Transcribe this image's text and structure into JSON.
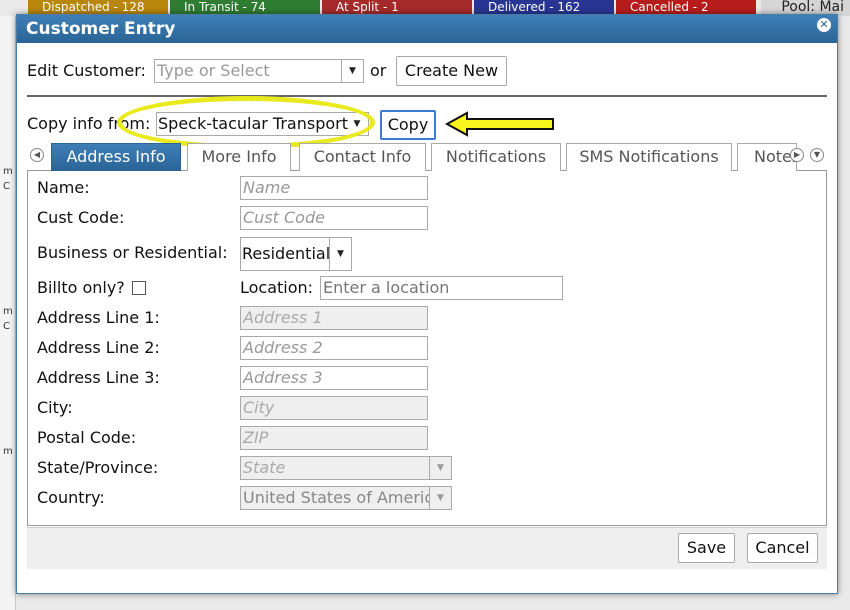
{
  "background": {
    "pills": [
      {
        "label": "Dispatched - 128",
        "color": "#b8860b",
        "width": 140
      },
      {
        "label": "In Transit - 74",
        "color": "#2e7d32",
        "width": 150
      },
      {
        "label": "At Split - 1",
        "color": "#a52a2a",
        "width": 150
      },
      {
        "label": "Delivered - 162",
        "color": "#283593",
        "width": 140
      },
      {
        "label": "Cancelled - 2",
        "color": "#b71c1c",
        "width": 140
      }
    ],
    "pool_label": "Pool: Mai"
  },
  "dialog": {
    "title": "Customer Entry",
    "close_icon": "close-icon"
  },
  "edit_customer": {
    "label": "Edit Customer:",
    "placeholder": "Type or Select",
    "or_text": "or",
    "create_new_label": "Create New"
  },
  "copy_info": {
    "label": "Copy info from:",
    "selected": "Speck-tacular Transport",
    "copy_label": "Copy",
    "highlight_color": "#e9ea1d"
  },
  "tabs": [
    {
      "label": "Address Info",
      "active": true
    },
    {
      "label": "More Info",
      "active": false
    },
    {
      "label": "Contact Info",
      "active": false
    },
    {
      "label": "Notifications",
      "active": false
    },
    {
      "label": "SMS Notifications",
      "active": false
    },
    {
      "label": "Notes",
      "active": false
    }
  ],
  "form": {
    "name_label": "Name:",
    "name_placeholder": "Name",
    "cust_code_label": "Cust Code:",
    "cust_code_placeholder": "Cust Code",
    "business_label": "Business or Residential:",
    "business_value": "Residential",
    "billto_label": "Billto only?",
    "location_label": "Location:",
    "location_placeholder": "Enter a location",
    "addr1_label": "Address Line 1:",
    "addr1_placeholder": "Address 1",
    "addr2_label": "Address Line 2:",
    "addr2_placeholder": "Address 2",
    "addr3_label": "Address Line 3:",
    "addr3_placeholder": "Address 3",
    "city_label": "City:",
    "city_placeholder": "City",
    "postal_label": "Postal Code:",
    "postal_placeholder": "ZIP",
    "state_label": "State/Province:",
    "state_placeholder": "State",
    "country_label": "Country:",
    "country_value": "United States of America"
  },
  "footer": {
    "save_label": "Save",
    "cancel_label": "Cancel"
  }
}
